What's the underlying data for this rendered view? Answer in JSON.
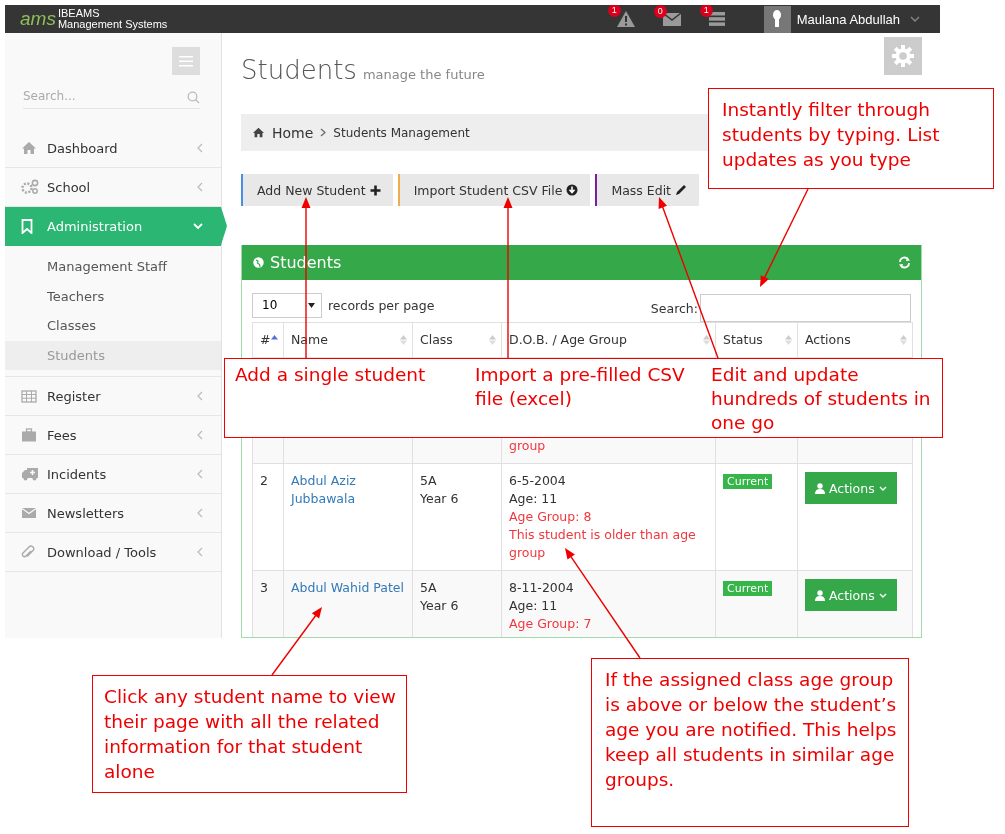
{
  "top_bar": {
    "logo_text": "ams",
    "brand": "IBEAMS",
    "brand_sub": "Management Systems",
    "notifications": [
      {
        "kind": "alert",
        "count": "1"
      },
      {
        "kind": "mail",
        "count": "0"
      },
      {
        "kind": "tasks",
        "count": "1"
      }
    ],
    "user": "Maulana Abdullah"
  },
  "sidebar": {
    "search_placeholder": "Search...",
    "items": [
      {
        "kind": "home",
        "label": "Dashboard",
        "selected": false,
        "expanded": false
      },
      {
        "kind": "cogs",
        "label": "School",
        "selected": false,
        "expanded": false
      },
      {
        "kind": "bookmark",
        "label": "Administration",
        "selected": true,
        "expanded": true,
        "children": [
          {
            "label": "Management Staff",
            "selected": false
          },
          {
            "label": "Teachers",
            "selected": false
          },
          {
            "label": "Classes",
            "selected": false
          },
          {
            "label": "Students",
            "selected": true
          }
        ]
      },
      {
        "kind": "table",
        "label": "Register",
        "selected": false,
        "expanded": false
      },
      {
        "kind": "briefcase",
        "label": "Fees",
        "selected": false,
        "expanded": false
      },
      {
        "kind": "ambulance",
        "label": "Incidents",
        "selected": false,
        "expanded": false
      },
      {
        "kind": "envelope",
        "label": "Newsletters",
        "selected": false,
        "expanded": false
      },
      {
        "kind": "paperclip",
        "label": "Download / Tools",
        "selected": false,
        "expanded": false
      }
    ]
  },
  "page": {
    "title": "Students",
    "subtitle": "manage the future",
    "breadcrumb": [
      "Home",
      "Students Management"
    ],
    "actions": [
      {
        "kind": "add",
        "label": "Add New Student"
      },
      {
        "kind": "import",
        "label": "Import Student CSV File"
      },
      {
        "kind": "edit",
        "label": "Mass Edit"
      }
    ],
    "panel": {
      "title": "Students",
      "page_size": "10",
      "page_size_label": "records per page",
      "search_label": "Search:",
      "columns": [
        {
          "label": "#",
          "sorted": true
        },
        {
          "label": "Name",
          "sorted": false
        },
        {
          "label": "Class",
          "sorted": false
        },
        {
          "label": "D.O.B. / Age Group",
          "sorted": false
        },
        {
          "label": "Status",
          "sorted": false
        },
        {
          "label": "Actions",
          "sorted": false
        }
      ],
      "rows": [
        {
          "kind": "covered",
          "warning": "group"
        },
        {
          "kind": "full",
          "number": "2",
          "name": "Abdul Aziz Jubbawala",
          "class": "5A",
          "year": "Year 6",
          "dob": "6-5-2004",
          "age": "Age: 11",
          "age_group": "Age Group: 8",
          "warning": "This student is older than age group",
          "status": "Current",
          "action": "Actions"
        },
        {
          "kind": "full",
          "number": "3",
          "name": "Abdul Wahid Patel",
          "class": "5A",
          "year": "Year 6",
          "dob": "8-11-2004",
          "age": "Age: 11",
          "age_group": "Age Group: 7",
          "status": "Current",
          "action": "Actions"
        }
      ]
    }
  },
  "annotations": [
    {
      "texts": [
        "Instantly filter through students by typing. List updates as you type"
      ]
    },
    {
      "texts": [
        "Add a single student",
        "Import a pre-filled CSV file (excel)",
        "Edit and update hundreds of students in one go"
      ]
    },
    {
      "texts": [
        "Click any student name to view their page with all the related information for that student alone"
      ]
    },
    {
      "texts": [
        "If the assigned class age group is above or below the student’s age you are notified. This helps keep all students in similar age groups."
      ]
    }
  ]
}
